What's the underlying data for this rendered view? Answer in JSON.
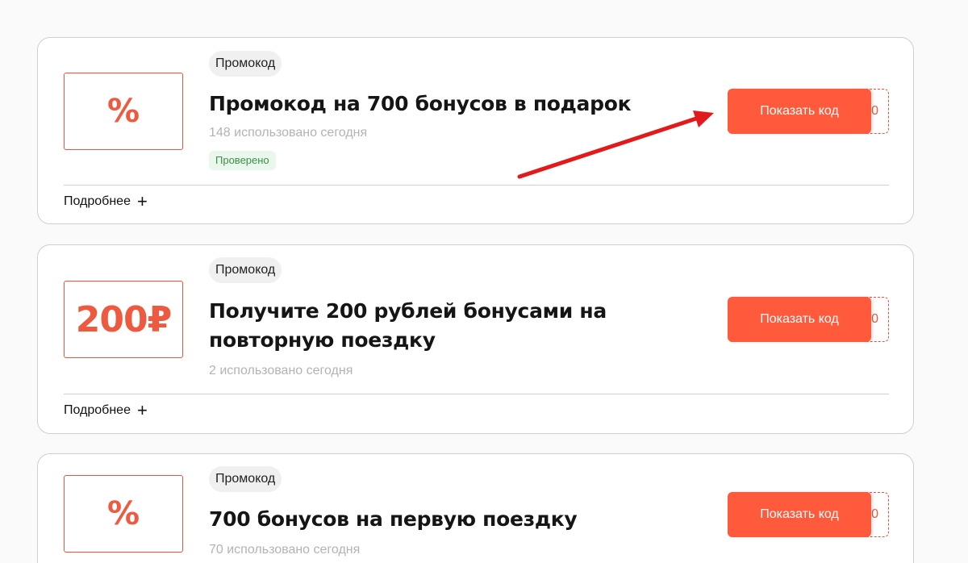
{
  "colors": {
    "accent": "#ff5a3c",
    "border": "#cfcfcf",
    "muted_text": "#b3b3b3",
    "verified_bg": "#eaf7ec",
    "verified_text": "#3c8f49",
    "annotation_arrow": "#e11b1b"
  },
  "offers": [
    {
      "badge": "%",
      "type": "Промокод",
      "title": "Промокод на 700 бонусов в подарок",
      "used": "148 использовано сегодня",
      "verified": "Проверено",
      "button": "Показать код",
      "code_tail": "0",
      "details": "Подробнее",
      "details_icon": "plus-icon"
    },
    {
      "badge": "200₽",
      "type": "Промокод",
      "title": "Получите 200 рублей бонусами на повторную поездку",
      "used": "2 использовано сегодня",
      "button": "Показать код",
      "code_tail": "0",
      "details": "Подробнее",
      "details_icon": "plus-icon"
    },
    {
      "badge": "%",
      "type": "Промокод",
      "title": "700 бонусов на первую поездку",
      "used": "70 использовано сегодня",
      "button": "Показать код",
      "code_tail": "0"
    }
  ]
}
